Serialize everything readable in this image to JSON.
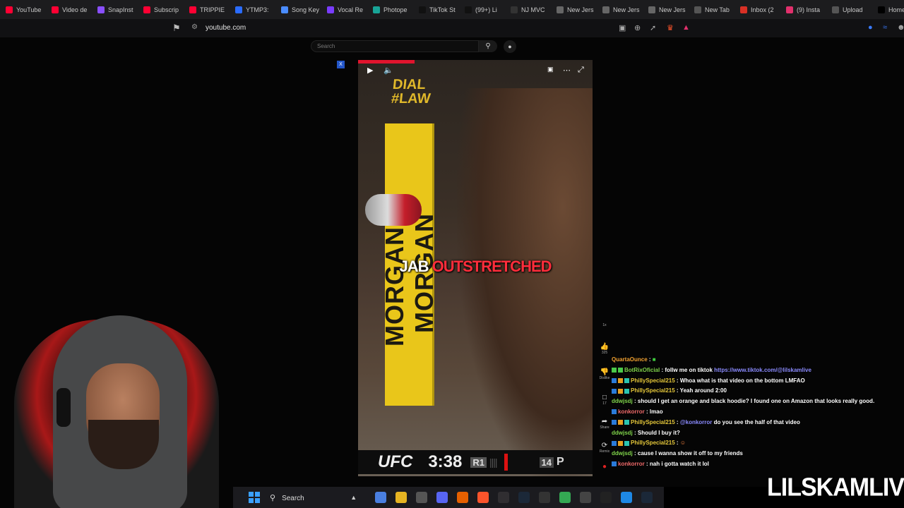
{
  "browser": {
    "tabs": [
      {
        "label": "YouTube",
        "icon": "youtube-icon",
        "color": "#ff0033"
      },
      {
        "label": "Video de",
        "icon": "youtube-icon",
        "color": "#ff0033"
      },
      {
        "label": "SnapInst",
        "icon": "snapinsta-icon",
        "color": "#8a4fff"
      },
      {
        "label": "Subscrip",
        "icon": "youtube-icon",
        "color": "#ff0033"
      },
      {
        "label": "TRIPPIE",
        "icon": "youtube-icon",
        "color": "#ff0033"
      },
      {
        "label": "YTMP3:",
        "icon": "ytmp3-icon",
        "color": "#2a6cff"
      },
      {
        "label": "Song Key",
        "icon": "songkey-icon",
        "color": "#4a8cff"
      },
      {
        "label": "Vocal Re",
        "icon": "vocal-icon",
        "color": "#7a3cff"
      },
      {
        "label": "Photope",
        "icon": "photopea-icon",
        "color": "#18a497"
      },
      {
        "label": "TikTok St",
        "icon": "tiktok-icon",
        "color": "#111111"
      },
      {
        "label": "(99+) Li",
        "icon": "tiktok-icon",
        "color": "#111111"
      },
      {
        "label": "NJ MVC",
        "icon": "nj-mvc-icon",
        "color": "#333333"
      },
      {
        "label": "New Jers",
        "icon": "globe-icon",
        "color": "#666666"
      },
      {
        "label": "New Jers",
        "icon": "globe-icon",
        "color": "#666666"
      },
      {
        "label": "New Jers",
        "icon": "globe-icon",
        "color": "#666666"
      },
      {
        "label": "New Tab",
        "icon": "brave-icon",
        "color": "#555555"
      },
      {
        "label": "Inbox (2",
        "icon": "gmail-icon",
        "color": "#d93025"
      },
      {
        "label": "(9) Insta",
        "icon": "instagram-icon",
        "color": "#e1306c"
      },
      {
        "label": "Upload",
        "icon": "upload-icon",
        "color": "#555555"
      },
      {
        "label": "Home /",
        "icon": "x-icon",
        "color": "#000000"
      }
    ],
    "url": "youtube.com"
  },
  "youtube": {
    "search_placeholder": "Search",
    "video_caption_white": "JAB",
    "video_caption_red": "OUTSTRETCHED",
    "pole_text": "MORGAN & MORGAN",
    "dial_text_1": "DIAL",
    "dial_text_2": "#LAW",
    "scoreboard": {
      "brand": "UFC",
      "time": "3:38",
      "round": "R1",
      "number": "14",
      "extra": "P"
    },
    "actions": {
      "top_label": "1x",
      "likes": "325",
      "dislike": "Dislike",
      "comments": "17",
      "share": "Share",
      "remix": "Remix"
    }
  },
  "chat": [
    {
      "user": "QuartaOunce",
      "color": "u-o",
      "badges": [],
      "text": "",
      "mention": "",
      "link": "",
      "emote": "green-emote"
    },
    {
      "user": "BotRixOficial",
      "color": "u-g",
      "badges": [
        "#4ac94a",
        "#4ac94a"
      ],
      "text": "follw me on tiktok",
      "mention": "",
      "link": "https://www.tiktok.com/@lilskamlive",
      "emote": ""
    },
    {
      "user": "PhillySpecial215",
      "color": "u-y",
      "badges": [
        "#2a7ad8",
        "#e6a020",
        "#2ac4b0"
      ],
      "text": "Whoa what is that video on the bottom LMFAO",
      "mention": "",
      "link": "",
      "emote": ""
    },
    {
      "user": "PhillySpecial215",
      "color": "u-y",
      "badges": [
        "#2a7ad8",
        "#e6a020",
        "#2ac4b0"
      ],
      "text": "Yeah around 2:00",
      "mention": "",
      "link": "",
      "emote": ""
    },
    {
      "user": "ddwjsdj",
      "color": "u-g",
      "badges": [],
      "text": "should I get an orange and black hoodie? I found one on Amazon that looks really good.",
      "mention": "",
      "link": "",
      "emote": ""
    },
    {
      "user": "konkorror",
      "color": "u-r",
      "badges": [
        "#2a7ad8"
      ],
      "text": "lmao",
      "mention": "",
      "link": "",
      "emote": ""
    },
    {
      "user": "PhillySpecial215",
      "color": "u-y",
      "badges": [
        "#2a7ad8",
        "#e6a020",
        "#2ac4b0"
      ],
      "text": "do you see the half of that video",
      "mention": "@konkorror",
      "link": "",
      "emote": ""
    },
    {
      "user": "ddwjsdj",
      "color": "u-g",
      "badges": [],
      "text": "Should I buy it?",
      "mention": "",
      "link": "",
      "emote": ""
    },
    {
      "user": "PhillySpecial215",
      "color": "u-y",
      "badges": [
        "#2a7ad8",
        "#e6a020",
        "#2ac4b0"
      ],
      "text": "",
      "mention": "",
      "link": "",
      "emote": "laugh-emote"
    },
    {
      "user": "ddwjsdj",
      "color": "u-g",
      "badges": [],
      "text": "cause I wanna show it off to my friends",
      "mention": "",
      "link": "",
      "emote": ""
    },
    {
      "user": "konkorror",
      "color": "u-r",
      "badges": [
        "#2a7ad8"
      ],
      "text": "nah i gotta watch it lol",
      "mention": "",
      "link": "",
      "emote": ""
    }
  ],
  "watermark": "LILSKAMLIVE",
  "taskbar": {
    "search_label": "Search",
    "apps": [
      {
        "icon": "copilot-icon",
        "color": "#4a7fe0"
      },
      {
        "icon": "file-explorer-icon",
        "color": "#e6b422"
      },
      {
        "icon": "store-icon",
        "color": "#555555"
      },
      {
        "icon": "discord-icon",
        "color": "#5865f2"
      },
      {
        "icon": "firefox-icon",
        "color": "#e66000"
      },
      {
        "icon": "brave-icon",
        "color": "#fb542b"
      },
      {
        "icon": "obs-icon",
        "color": "#302e31"
      },
      {
        "icon": "steam-icon",
        "color": "#1b2838"
      },
      {
        "icon": "msi-icon",
        "color": "#333333"
      },
      {
        "icon": "chrome-icon",
        "color": "#34a853"
      },
      {
        "icon": "4k-icon",
        "color": "#444444"
      },
      {
        "icon": "capcut-icon",
        "color": "#222222"
      },
      {
        "icon": "notepad-icon",
        "color": "#1e88e5"
      },
      {
        "icon": "steam-icon",
        "color": "#1b2838"
      }
    ]
  }
}
